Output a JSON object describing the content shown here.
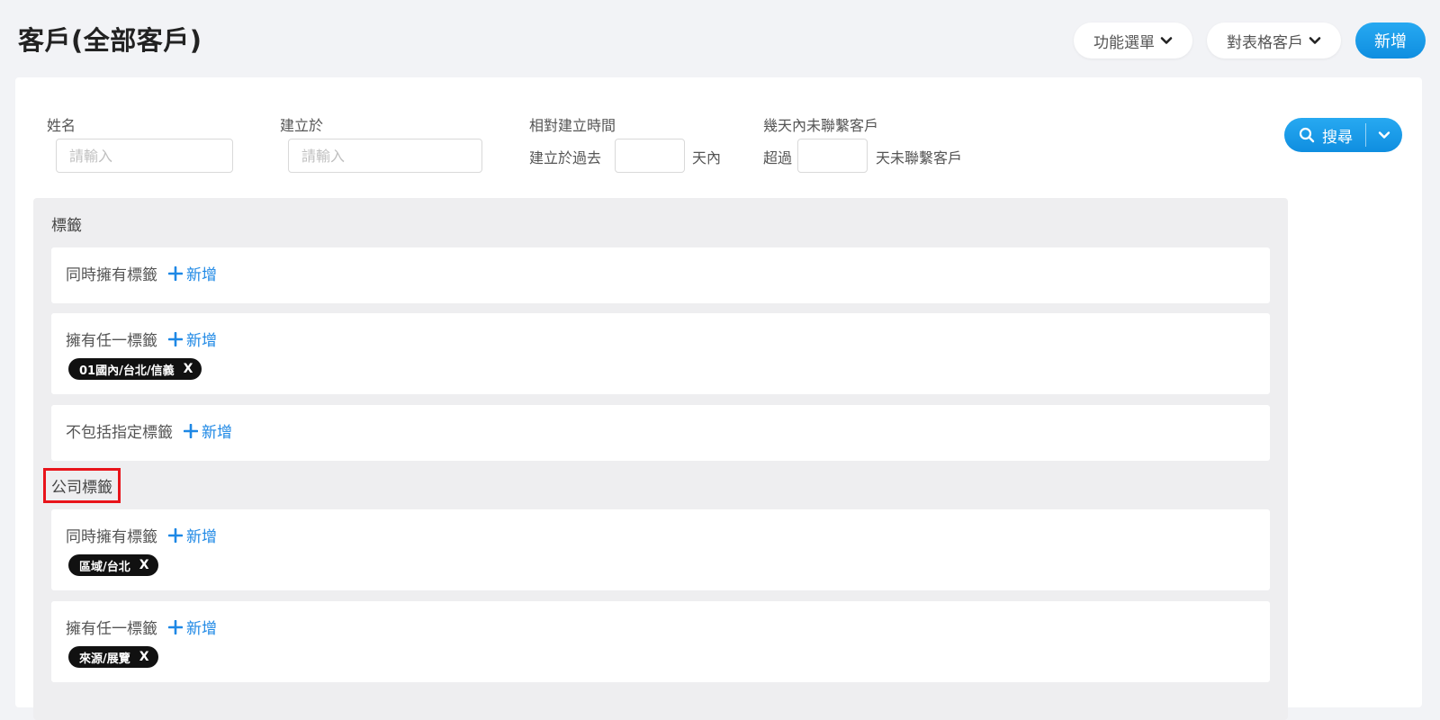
{
  "header": {
    "title": "客戶(全部客戶)",
    "menu_button": "功能選單",
    "table_button": "對表格客戶",
    "add_button": "新增"
  },
  "filters": {
    "name": {
      "label": "姓名",
      "placeholder": "請輸入"
    },
    "created_at": {
      "label": "建立於",
      "placeholder": "請輸入"
    },
    "relative_created": {
      "label": "相對建立時間",
      "prefix": "建立於過去",
      "suffix": "天內"
    },
    "no_contact": {
      "label": "幾天內未聯繫客戶",
      "prefix": "超過",
      "suffix": "天未聯繫客戶"
    },
    "search_button": "搜尋"
  },
  "tags": {
    "title": "標籤",
    "rows": [
      {
        "label": "同時擁有標籤",
        "add": "新增",
        "chips": []
      },
      {
        "label": "擁有任一標籤",
        "add": "新增",
        "chips": [
          "01國內/台北/信義"
        ]
      },
      {
        "label": "不包括指定標籤",
        "add": "新增",
        "chips": []
      }
    ]
  },
  "company_tags": {
    "title": "公司標籤",
    "rows": [
      {
        "label": "同時擁有標籤",
        "add": "新增",
        "chips": [
          "區域/台北"
        ]
      },
      {
        "label": "擁有任一標籤",
        "add": "新增",
        "chips": [
          "來源/展覽"
        ]
      }
    ]
  },
  "chip_close": "X",
  "colors": {
    "accent": "#1e88e5",
    "primary_gradient_top": "#27a9f1",
    "chip_bg": "#111111",
    "highlight_box": "#e8141b"
  }
}
